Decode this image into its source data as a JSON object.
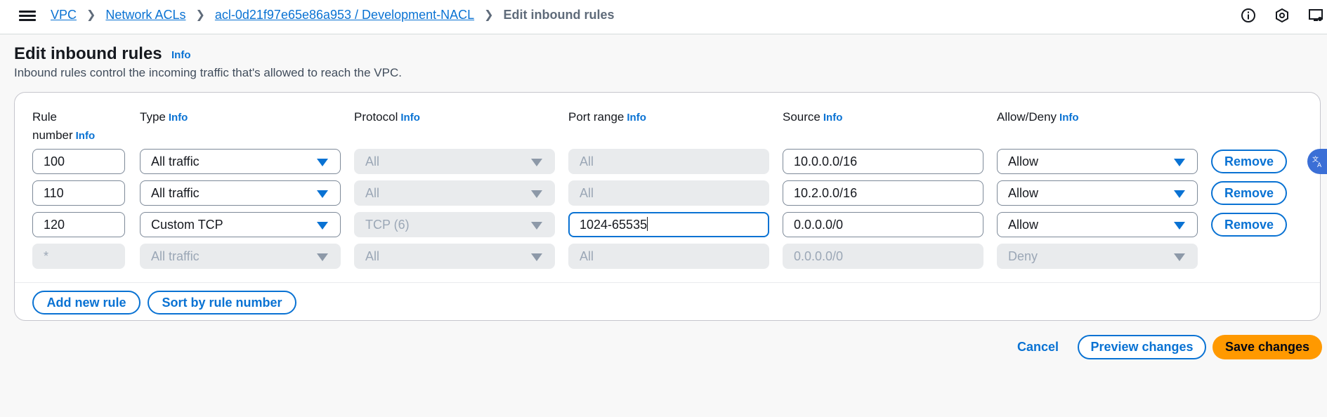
{
  "breadcrumb": {
    "items": [
      "VPC",
      "Network ACLs",
      "acl-0d21f97e65e86a953 / Development-NACL"
    ],
    "current": "Edit inbound rules"
  },
  "header": {
    "title": "Edit inbound rules",
    "info": "Info",
    "description": "Inbound rules control the incoming traffic that's allowed to reach the VPC."
  },
  "columns": {
    "rule_number_line1": "Rule",
    "rule_number_line2": "number",
    "type": "Type",
    "protocol": "Protocol",
    "port_range": "Port range",
    "source": "Source",
    "allow_deny": "Allow/Deny",
    "info": "Info"
  },
  "rules": [
    {
      "rule_number": "100",
      "type": "All traffic",
      "protocol": "All",
      "port_range": "All",
      "source": "10.0.0.0/16",
      "action": "Allow",
      "remove": "Remove"
    },
    {
      "rule_number": "110",
      "type": "All traffic",
      "protocol": "All",
      "port_range": "All",
      "source": "10.2.0.0/16",
      "action": "Allow",
      "remove": "Remove"
    },
    {
      "rule_number": "120",
      "type": "Custom TCP",
      "protocol": "TCP (6)",
      "port_range": "1024-65535",
      "source": "0.0.0.0/0",
      "action": "Allow",
      "remove": "Remove"
    },
    {
      "rule_number": "*",
      "type": "All traffic",
      "protocol": "All",
      "port_range": "All",
      "source": "0.0.0.0/0",
      "action": "Deny"
    }
  ],
  "actions": {
    "add_new_rule": "Add new rule",
    "sort_by_rule_number": "Sort by rule number",
    "cancel": "Cancel",
    "preview_changes": "Preview changes",
    "save_changes": "Save changes"
  },
  "colors": {
    "accent": "#0972d3",
    "primary_button": "#ff9900",
    "disabled_field": "#e9ebed"
  },
  "icons": [
    "menu-icon",
    "chevron-right-icon",
    "info-circle-icon",
    "settings-hexagon-icon",
    "screen-icon",
    "caret-down-icon",
    "translate-icon"
  ]
}
